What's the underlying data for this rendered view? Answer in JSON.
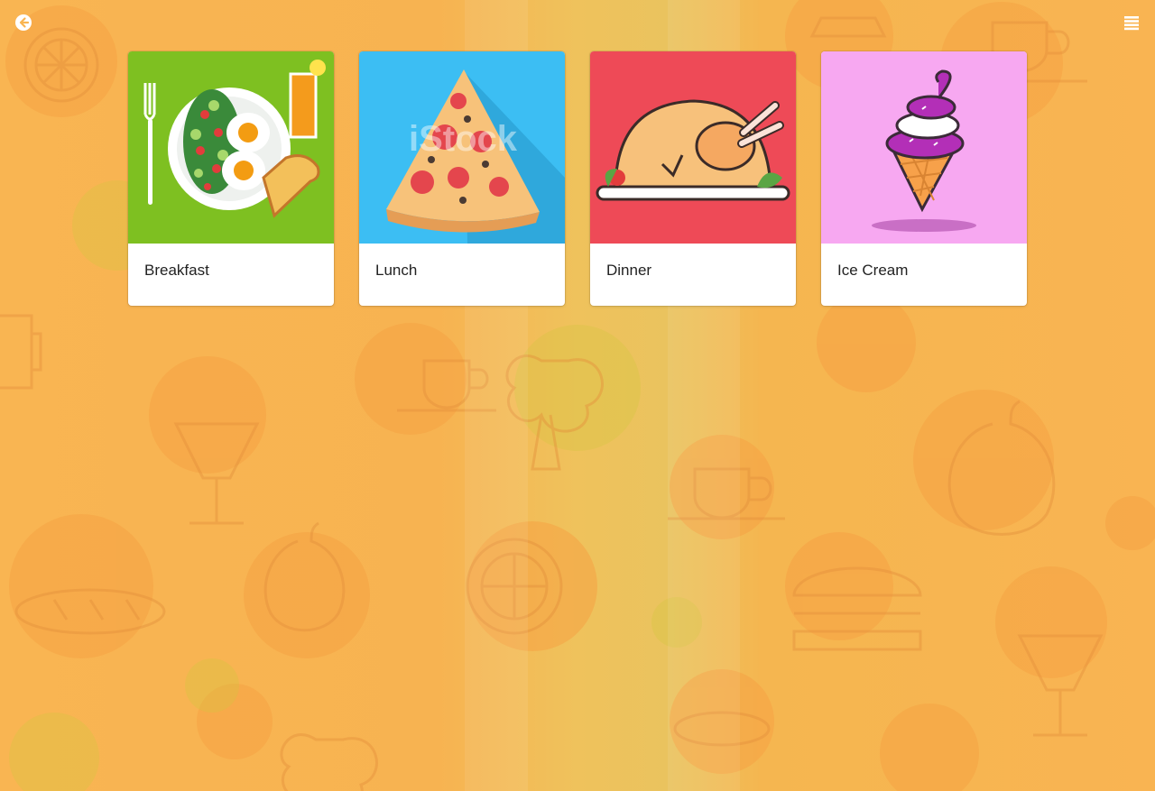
{
  "header": {
    "back_icon": "arrow-left-circle-icon",
    "menu_icon": "list-icon"
  },
  "cards": [
    {
      "title": "Breakfast",
      "image": "breakfast-plate-illustration",
      "bg_color": "#7ec021"
    },
    {
      "title": "Lunch",
      "image": "pizza-slice-illustration",
      "bg_color": "#3cbef3",
      "watermark": "iStock"
    },
    {
      "title": "Dinner",
      "image": "roast-turkey-illustration",
      "bg_color": "#ee4a57"
    },
    {
      "title": "Ice Cream",
      "image": "ice-cream-cone-illustration",
      "bg_color": "#f7a8f1"
    }
  ],
  "colors": {
    "background": "#f9b552",
    "card": "#ffffff",
    "icon": "#ffffff"
  }
}
